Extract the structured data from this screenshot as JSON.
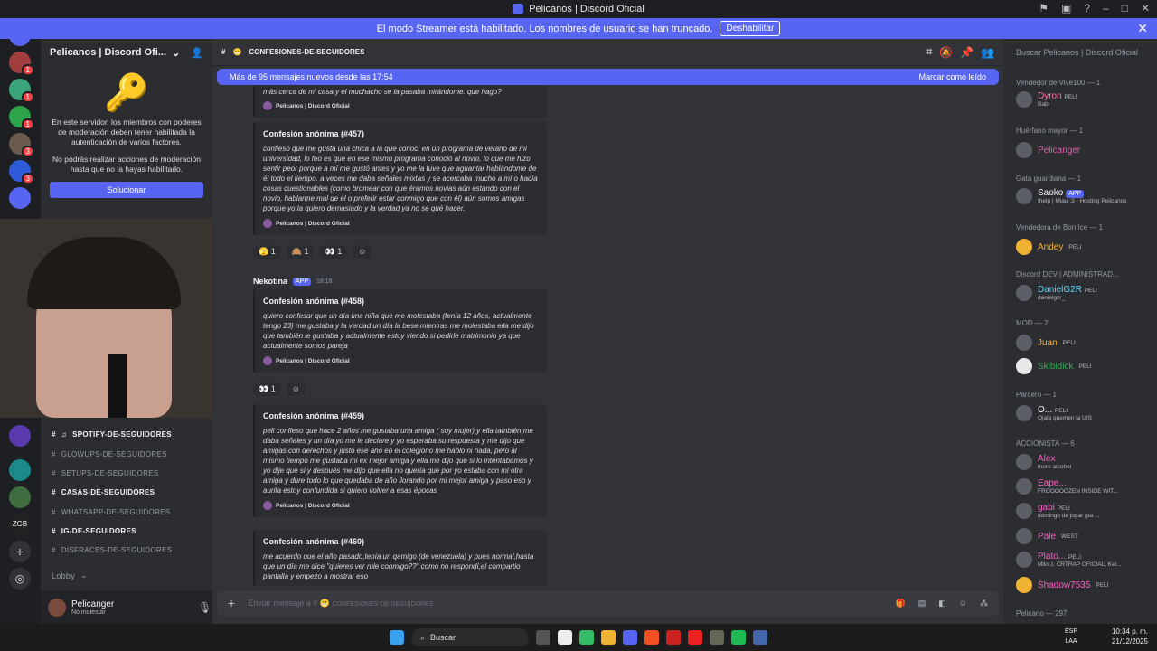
{
  "window": {
    "title": "Pelicanos | Discord Oficial"
  },
  "banner": {
    "text": "El modo Streamer está habilitado. Los nombres de usuario se han truncado.",
    "button": "Deshabilitar"
  },
  "guild": {
    "name": "Pelicanos | Discord Ofi..."
  },
  "mfa": {
    "line1": "En este servidor, los miembros con poderes de moderación deben tener habilitada la autenticación de varios factores.",
    "line2": "No podrás realizar acciones de moderación hasta que no la hayas habilitado.",
    "button": "Solucionar"
  },
  "channels": [
    {
      "name": "spotify-de-seguidores",
      "bold": true
    },
    {
      "name": "glowups-de-seguidores",
      "bold": false
    },
    {
      "name": "setups-de-seguidores",
      "bold": false
    },
    {
      "name": "casas-de-seguidores",
      "bold": true
    },
    {
      "name": "whatsapp-de-seguidores",
      "bold": false
    },
    {
      "name": "ig-de-seguidores",
      "bold": true
    },
    {
      "name": "disfraces-de-seguidores",
      "bold": false
    }
  ],
  "lobby": "Lobby",
  "user": {
    "name": "Pelicanger",
    "status": "No molestar"
  },
  "server_badges": [
    "1K+",
    "1",
    "1",
    "1",
    "3",
    "3"
  ],
  "channel_header": "confesiones-de-seguidores",
  "newbar": {
    "left": "Más de 95 mensajes nuevos desde las 17:54",
    "right": "Marcar como leído"
  },
  "top_partial": "más cerca de mi casa y el muchacho se la pasaba mirándome. que hago?",
  "footer": "Pelicanos | Discord Oficial",
  "messages": [
    {
      "title": "Confesión anónima (#457)",
      "body": "confieso que me gusta una chica a la que conocí en un programa de verano de mi universidad, lo feo es que en ese mismo programa conoció al novio, lo que me hizo sentir peor porque a mí me gustó antes y yo me la tuve que aguantar hablándome de él todo el tiempo. a veces me daba señales mixtas y se acercaba mucho a mí o hacía cosas cuestionables (como bromear con que éramos novias aún estando con el novio, hablarme mal de él o preferir estar conmigo que con él) aún somos amigas porque yo la quiero demasiado y la verdad ya no sé qué hacer."
    },
    {
      "title": "Confesión anónima (#458)",
      "body": "quiero confesar que un día una niña que me molestaba (tenía 12 años, actualmente tengo 23) me gustaba y la verdad un día la bese mientras me molestaba ella me dijo que también le gustaba y actualmente estoy viendo si pedirle matrimonio ya que actualmente somos pareja"
    },
    {
      "title": "Confesión anónima (#459)",
      "body": "peli confieso que hace 2 años me gustaba una amiga ( soy mujer) y ella también me daba señales y un día yo me le declare y yo esperaba su respuesta y me dijo que amigas con derechos y justo ese año en el colegiono me hablo ni nada, pero al mismo tiempo me gustaba mi ex mejor amiga y ella me dijo que si lo intentábamos y yo dije que si y después me dijo que ella no quería que por yo estaba con mi otra amiga y dure todo lo que quedaba de año llorando por mi mejor amiga y paso eso y aurita estoy confundida si quiero volver a esas épocas"
    },
    {
      "title": "Confesión anónima (#460)",
      "body": "me acuerdo que el año pasado,tenía un qamigo (de venezuela) y pues normal,hasta que un día me dice \"quieres ver rule conmigo??\" como no respondí,el compartio pantalla y empezo a mostrar eso"
    }
  ],
  "reactions1": [
    "1",
    "1",
    "1"
  ],
  "reactions2": [
    "1"
  ],
  "author": {
    "name": "Nekotina",
    "tag": "APP",
    "time": "18:18"
  },
  "composer": {
    "placeholder": "Enviar mensaje a #",
    "channel": "confesiones-de-seguidores"
  },
  "member_search": "Buscar Pelicanos | Discord Oficial",
  "member_groups": [
    {
      "label": "Vendedor de Vive100 — 1"
    },
    {
      "label": "Huérfano mayor — 1"
    },
    {
      "label": "Gata guardiana — 1"
    },
    {
      "label": "Vendedora de Bon Ice — 1"
    },
    {
      "label": "Discord DEV | ADMINISTRAD..."
    },
    {
      "label": "MOD — 2"
    },
    {
      "label": "Parcero — 1"
    },
    {
      "label": "ACCIONISTA — 6"
    },
    {
      "label": "Pelicano — 297"
    }
  ],
  "members": [
    {
      "name": "Dyron",
      "tag": "PELI",
      "sub": "Babi",
      "color": "#ff6fa8"
    },
    {
      "name": "Pelicanger",
      "tag": "",
      "sub": "",
      "color": "#e65cb0"
    },
    {
      "name": "Saoko",
      "tag": "APP",
      "sub": "!help | Miau :3 - Hosting Pelicanos",
      "color": "#f2f3f5"
    },
    {
      "name": "Andey",
      "tag": "PELI",
      "sub": "",
      "color": "#f0b232"
    },
    {
      "name": "DanielG2R",
      "tag": "PELI",
      "sub": "danielgzr_",
      "color": "#5fd4ff"
    },
    {
      "name": "Juan",
      "tag": "PELI",
      "sub": "",
      "color": "#f0b232"
    },
    {
      "name": "Skibidick",
      "tag": "PELI",
      "sub": "",
      "color": "#3ba55c"
    },
    {
      "name": "O...",
      "tag": "PELI",
      "sub": "Ojala quemen la UIS",
      "color": "#f2f3f5"
    },
    {
      "name": "Alex",
      "tag": "",
      "sub": "more alcohol",
      "color": "#ff5ec4"
    },
    {
      "name": "Eape...",
      "tag": "",
      "sub": "FROOOOOZEN INSIDE WIT...",
      "color": "#ff5ec4"
    },
    {
      "name": "gabi",
      "tag": "PELI",
      "sub": "domingo de jugar gta ...",
      "color": "#ff5ec4"
    },
    {
      "name": "Pale",
      "tag": "WEST",
      "sub": "",
      "color": "#ff5ec4"
    },
    {
      "name": "Plato...",
      "tag": "PELI",
      "sub": "Milo J, CRTRAP OFICIAL, Kel...",
      "color": "#ff5ec4"
    },
    {
      "name": "Shadow7535",
      "tag": "PELI",
      "sub": "",
      "color": "#ff5ec4"
    }
  ],
  "taskbar": {
    "search": "Buscar",
    "lang1": "ESP",
    "lang2": "LAA",
    "time": "10:34 p. m.",
    "date": "21/12/2025"
  }
}
